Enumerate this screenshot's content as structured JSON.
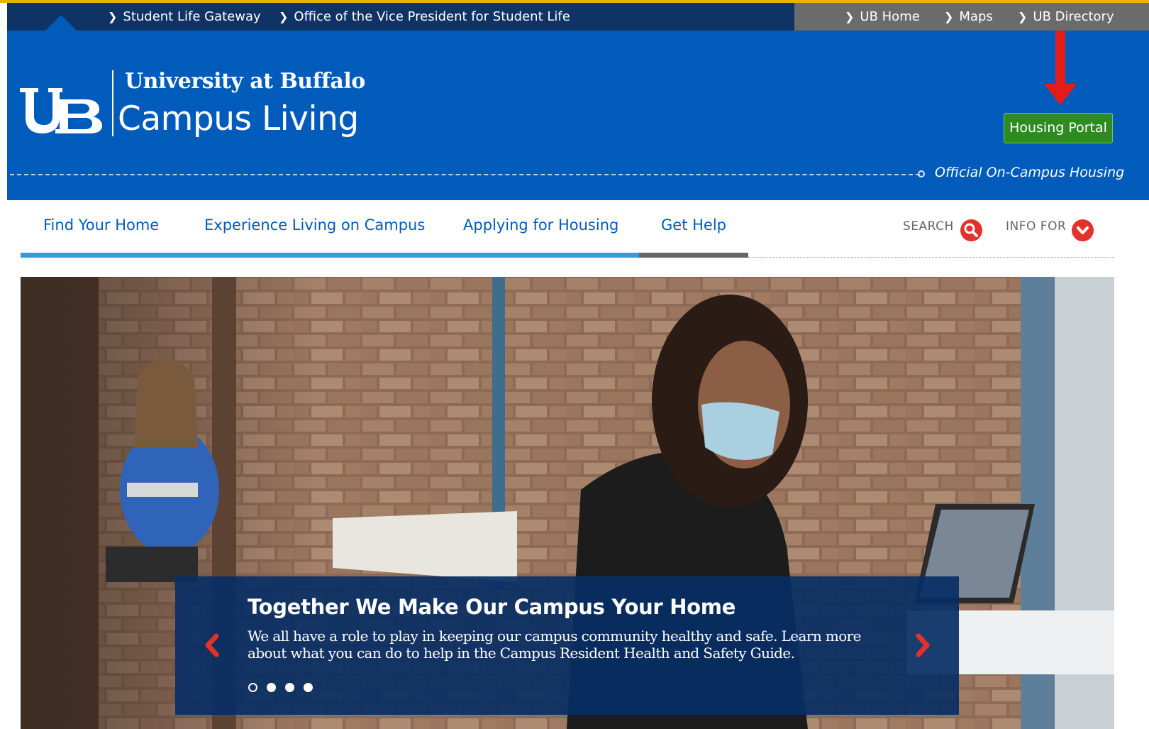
{
  "utility_nav": {
    "left_links": [
      {
        "label": "Student Life Gateway"
      },
      {
        "label": "Office of the Vice President for Student Life"
      }
    ],
    "right_links": [
      {
        "label": "UB Home"
      },
      {
        "label": "Maps"
      },
      {
        "label": "UB Directory"
      }
    ]
  },
  "header": {
    "university_name": "University at Buffalo",
    "site_name": "Campus Living",
    "tagline": "Official On-Campus Housing",
    "portal_button": "Housing Portal",
    "colors": {
      "brand_blue": "#005bbb",
      "portal_green": "#2e8b21",
      "annotation_red": "#e31b1b"
    }
  },
  "main_nav": {
    "items": [
      {
        "label": "Find Your Home"
      },
      {
        "label": "Experience Living on Campus"
      },
      {
        "label": "Applying for Housing"
      },
      {
        "label": "Get Help"
      }
    ],
    "search_label": "SEARCH",
    "info_for_label": "INFO FOR"
  },
  "hero": {
    "title": "Together We Make Our Campus Your Home",
    "text": "We all have a role to play in keeping our campus community healthy and safe. Learn more about what you can do to help in the Campus Resident Health and Safety Guide.",
    "slide_count": 4,
    "active_slide": 1,
    "icons": {
      "prev": "chevron-left-icon",
      "next": "chevron-right-icon"
    }
  }
}
